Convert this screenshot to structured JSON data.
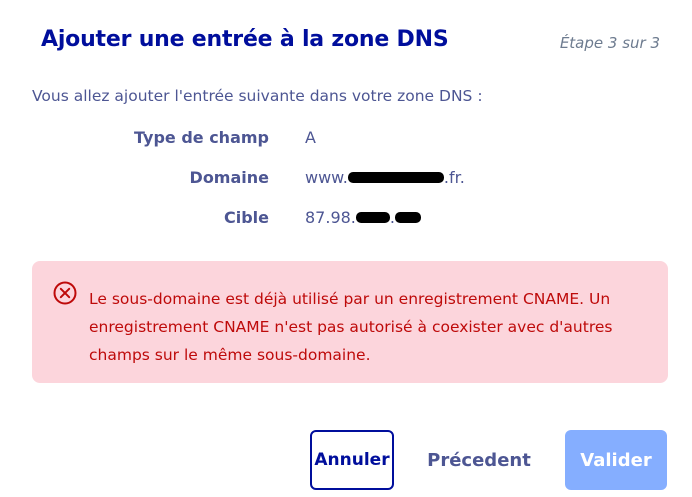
{
  "dialog": {
    "title": "Ajouter une entrée à la zone DNS",
    "step": "Étape 3 sur 3",
    "intro": "Vous allez ajouter l'entrée suivante dans votre zone DNS :"
  },
  "fields": [
    {
      "label": "Type de champ",
      "value": "A"
    },
    {
      "label": "Domaine",
      "value_prefix": "www.",
      "value_suffix": ".fr."
    },
    {
      "label": "Cible",
      "value_prefix": "87.98.",
      "value_mid": "."
    }
  ],
  "alert": {
    "icon": "error-circle-x-icon",
    "color": "#be0a0a",
    "background": "#fcd5dc",
    "message": "Le sous-domaine est déjà utilisé par un enregistrement CNAME. Un enregistrement CNAME n'est pas autorisé à coexister avec d'autres champs sur le même sous-domaine."
  },
  "buttons": {
    "cancel": "Annuler",
    "previous": "Précedent",
    "validate": "Valider"
  },
  "colors": {
    "primary": "#000e9c",
    "text": "#4d5693",
    "validate_disabled": "#85aeff"
  }
}
